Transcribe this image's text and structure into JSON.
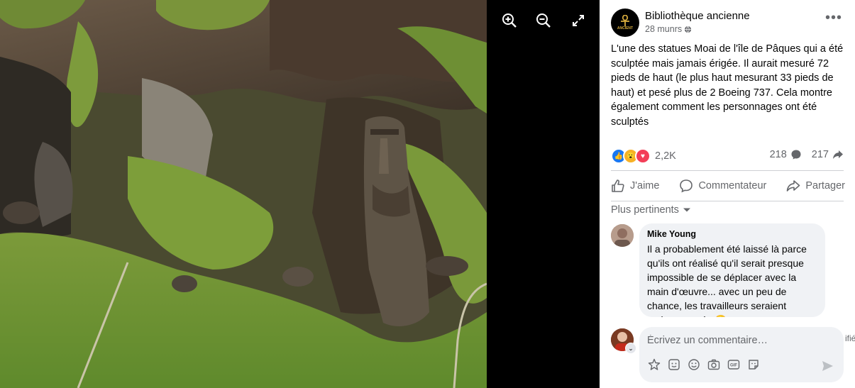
{
  "viewer": {
    "zoom_in_icon": "zoom-in-icon",
    "zoom_out_icon": "zoom-out-icon",
    "fullscreen_icon": "expand-icon"
  },
  "post": {
    "page_name": "Bibliothèque ancienne",
    "avatar_text": "ANCIENT",
    "time": "28 munrs",
    "audience_icon": "globe-icon",
    "text": "L'une des statues Moai de l'île de Pâques qui a été sculptée mais jamais érigée. Il aurait mesuré 72 pieds de haut (le plus haut mesurant 33 pieds de haut) et pesé plus de 2 Boeing 737. Cela montre également comment les personnages ont été sculptés",
    "reactions_count": "2,2K",
    "comments_count": "218",
    "shares_count": "217",
    "colors": {
      "like": "#1877f2",
      "wow": "#f7b125",
      "love": "#f33e58"
    }
  },
  "actions": {
    "like_label": "J'aime",
    "comment_label": "Commentateur",
    "share_label": "Partager"
  },
  "comments": {
    "sort_label": "Plus pertinents",
    "items": [
      {
        "author": "Mike Young",
        "text": "Il a probablement été laissé là parce qu'ils ont réalisé qu'il serait presque impossible de se déplacer avec la main d'œuvre... avec un peu de chance, les travailleurs seraient toujours payés 🤗"
      }
    ]
  },
  "composer": {
    "placeholder": "Écrivez un commentaire…",
    "cut_text": "ifié"
  }
}
